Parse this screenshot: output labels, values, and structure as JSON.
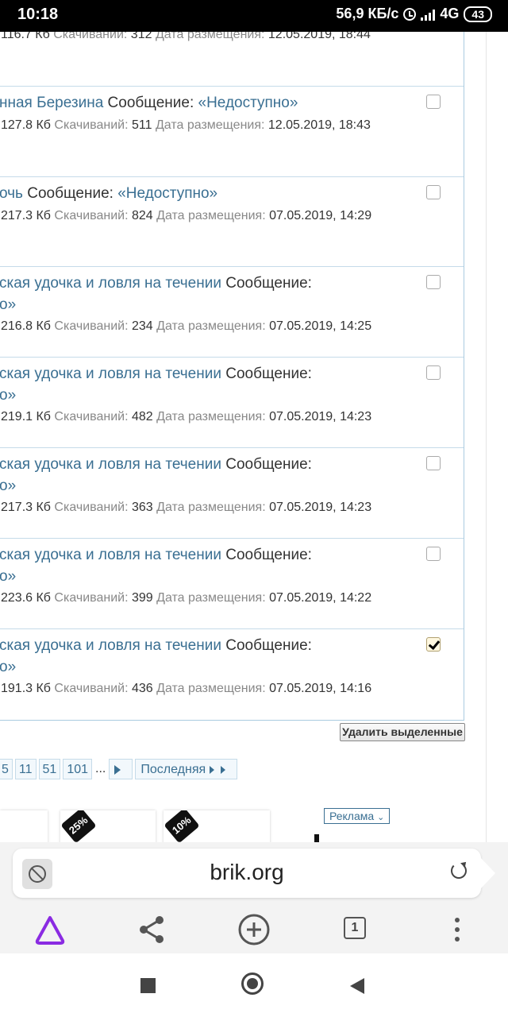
{
  "status": {
    "time": "10:18",
    "speed": "56,9 КБ/с",
    "network": "4G",
    "battery": "43"
  },
  "list": {
    "rows": [
      {
        "title_prefix": "",
        "title_link": "",
        "title_msg": "",
        "title_link2": "",
        "size": "116.7 Кб",
        "downloads_label": "Скачиваний:",
        "downloads": "312",
        "date_label": "Дата размещения:",
        "date": "12.05.2019, 18:44",
        "checked": false
      },
      {
        "title_prefix": "нная Березина",
        "title_msg": "Сообщение:",
        "title_link2": "«Недоступно»",
        "size": "127.8 Кб",
        "downloads_label": "Скачиваний:",
        "downloads": "511",
        "date_label": "Дата размещения:",
        "date": "12.05.2019, 18:43",
        "checked": false
      },
      {
        "title_prefix": "очь",
        "title_msg": "Сообщение:",
        "title_link2": "«Недоступно»",
        "size": "217.3 Кб",
        "downloads_label": "Скачиваний:",
        "downloads": "824",
        "date_label": "Дата размещения:",
        "date": "07.05.2019, 14:29",
        "checked": false
      },
      {
        "title_prefix": "ская удочка и ловля на течении",
        "title_msg": "Сообщение:",
        "title_line2": "о»",
        "size": "216.8 Кб",
        "downloads_label": "Скачиваний:",
        "downloads": "234",
        "date_label": "Дата размещения:",
        "date": "07.05.2019, 14:25",
        "checked": false
      },
      {
        "title_prefix": "ская удочка и ловля на течении",
        "title_msg": "Сообщение:",
        "title_line2": "о»",
        "size": "219.1 Кб",
        "downloads_label": "Скачиваний:",
        "downloads": "482",
        "date_label": "Дата размещения:",
        "date": "07.05.2019, 14:23",
        "checked": false
      },
      {
        "title_prefix": "ская удочка и ловля на течении",
        "title_msg": "Сообщение:",
        "title_line2": "о»",
        "size": "217.3 Кб",
        "downloads_label": "Скачиваний:",
        "downloads": "363",
        "date_label": "Дата размещения:",
        "date": "07.05.2019, 14:23",
        "checked": false
      },
      {
        "title_prefix": "ская удочка и ловля на течении",
        "title_msg": "Сообщение:",
        "title_line2": "о»",
        "size": "223.6 Кб",
        "downloads_label": "Скачиваний:",
        "downloads": "399",
        "date_label": "Дата размещения:",
        "date": "07.05.2019, 14:22",
        "checked": false
      },
      {
        "title_prefix": "ская удочка и ловля на течении",
        "title_msg": "Сообщение:",
        "title_line2": "о»",
        "size": "191.3 Кб",
        "downloads_label": "Скачиваний:",
        "downloads": "436",
        "date_label": "Дата размещения:",
        "date": "07.05.2019, 14:16",
        "checked": true
      }
    ],
    "delete_button": "Удалить выделенные"
  },
  "pager": {
    "pages": [
      "5",
      "11",
      "51",
      "101"
    ],
    "dots": "...",
    "last_label": "Последняя"
  },
  "ads": {
    "label": "Реклама",
    "badges": [
      "25%",
      "10%"
    ]
  },
  "browser": {
    "url": "brik.org",
    "tab_count": "1"
  }
}
